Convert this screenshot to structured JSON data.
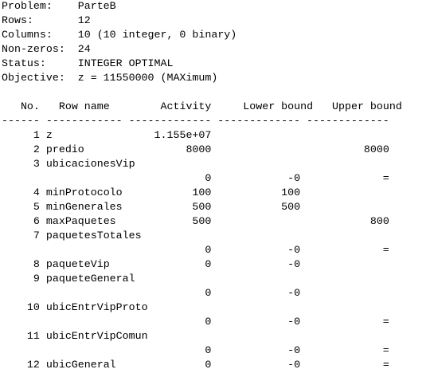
{
  "header": {
    "problem_label": "Problem:",
    "problem_value": "ParteB",
    "rows_label": "Rows:",
    "rows_value": "12",
    "columns_label": "Columns:",
    "columns_value": "10 (10 integer, 0 binary)",
    "nonzeros_label": "Non-zeros:",
    "nonzeros_value": "24",
    "status_label": "Status:",
    "status_value": "INTEGER OPTIMAL",
    "objective_label": "Objective:",
    "objective_value": "z = 11550000 (MAXimum)"
  },
  "table": {
    "columns": [
      "No.",
      "Row name",
      "Activity",
      "Lower bound",
      "Upper bound"
    ],
    "rows": [
      {
        "no": "1",
        "name": "z",
        "activity": "1.155e+07",
        "lower": "",
        "upper": "",
        "wrap": false
      },
      {
        "no": "2",
        "name": "predio",
        "activity": "8000",
        "lower": "",
        "upper": "8000",
        "wrap": false
      },
      {
        "no": "3",
        "name": "ubicacionesVip",
        "activity": "0",
        "lower": "-0",
        "upper": "=",
        "wrap": true
      },
      {
        "no": "4",
        "name": "minProtocolo",
        "activity": "100",
        "lower": "100",
        "upper": "",
        "wrap": false
      },
      {
        "no": "5",
        "name": "minGenerales",
        "activity": "500",
        "lower": "500",
        "upper": "",
        "wrap": false
      },
      {
        "no": "6",
        "name": "maxPaquetes",
        "activity": "500",
        "lower": "",
        "upper": "800",
        "wrap": false
      },
      {
        "no": "7",
        "name": "paquetesTotales",
        "activity": "0",
        "lower": "-0",
        "upper": "=",
        "wrap": true
      },
      {
        "no": "8",
        "name": "paqueteVip",
        "activity": "0",
        "lower": "-0",
        "upper": "",
        "wrap": false
      },
      {
        "no": "9",
        "name": "paqueteGeneral",
        "activity": "0",
        "lower": "-0",
        "upper": "",
        "wrap": true
      },
      {
        "no": "10",
        "name": "ubicEntrVipProto",
        "activity": "0",
        "lower": "-0",
        "upper": "=",
        "wrap": true
      },
      {
        "no": "11",
        "name": "ubicEntrVipComun",
        "activity": "0",
        "lower": "-0",
        "upper": "=",
        "wrap": true
      },
      {
        "no": "12",
        "name": "ubicGeneral",
        "activity": "0",
        "lower": "-0",
        "upper": "=",
        "wrap": false
      }
    ]
  }
}
